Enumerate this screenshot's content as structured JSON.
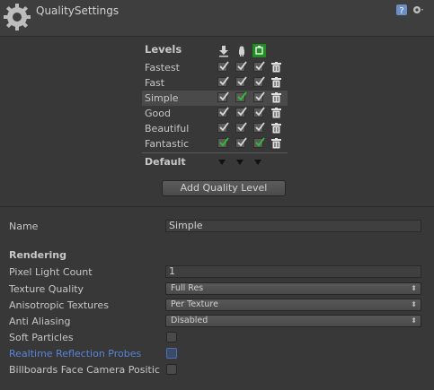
{
  "header": {
    "title": "QualitySettings",
    "icons": [
      "gear-icon",
      "help-icon",
      "settings-icon"
    ]
  },
  "levels": {
    "heading": "Levels",
    "platforms": [
      "standalone-download-icon",
      "android-icon",
      "windows-store-icon"
    ],
    "rows": [
      {
        "name": "Fastest",
        "checks": [
          true,
          true,
          true
        ],
        "selected": false,
        "default_platforms": [
          false,
          false,
          false
        ]
      },
      {
        "name": "Fast",
        "checks": [
          true,
          true,
          true
        ],
        "selected": false,
        "default_platforms": [
          false,
          false,
          false
        ]
      },
      {
        "name": "Simple",
        "checks": [
          true,
          true,
          true
        ],
        "selected": true,
        "default_platforms": [
          false,
          true,
          false
        ]
      },
      {
        "name": "Good",
        "checks": [
          true,
          true,
          true
        ],
        "selected": false,
        "default_platforms": [
          false,
          false,
          false
        ]
      },
      {
        "name": "Beautiful",
        "checks": [
          true,
          true,
          true
        ],
        "selected": false,
        "default_platforms": [
          false,
          false,
          false
        ]
      },
      {
        "name": "Fantastic",
        "checks": [
          true,
          true,
          true
        ],
        "selected": false,
        "default_platforms": [
          true,
          false,
          true
        ]
      }
    ],
    "default_label": "Default",
    "add_button": "Add Quality Level"
  },
  "colors": {
    "default_check": "#2ec42e",
    "normal_check": "#d8d8d8",
    "link": "#5a84d6"
  },
  "settings": {
    "name_label": "Name",
    "name_value": "Simple",
    "rendering_heading": "Rendering",
    "pixel_light_label": "Pixel Light Count",
    "pixel_light_value": "1",
    "texture_quality_label": "Texture Quality",
    "texture_quality_value": "Full Res",
    "aniso_label": "Anisotropic Textures",
    "aniso_value": "Per Texture",
    "aa_label": "Anti Aliasing",
    "aa_value": "Disabled",
    "soft_particles_label": "Soft Particles",
    "soft_particles_checked": false,
    "reflection_probes_label": "Realtime Reflection Probes",
    "reflection_probes_checked": false,
    "billboards_label": "Billboards Face Camera Positic",
    "billboards_checked": false
  }
}
